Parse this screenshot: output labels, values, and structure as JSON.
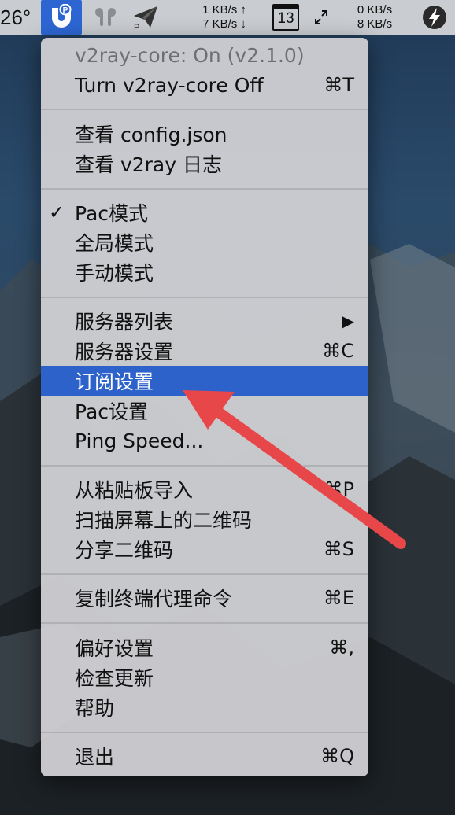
{
  "menubar": {
    "temperature": "26°",
    "net_left": {
      "up": "1 KB/s ↑",
      "down": "7 KB/s ↓"
    },
    "calendar_day": "13",
    "net_right": {
      "up": "0 KB/s",
      "down": "8 KB/s"
    }
  },
  "menu": {
    "status": "v2ray-core: On  (v2.1.0)",
    "toggle": {
      "label": "Turn v2ray-core Off",
      "shortcut": "⌘T"
    },
    "view_config": "查看 config.json",
    "view_log": "查看 v2ray 日志",
    "mode_pac": "Pac模式",
    "mode_pac_check": "✓",
    "mode_global": "全局模式",
    "mode_manual": "手动模式",
    "server_list": {
      "label": "服务器列表",
      "submenu": "▶"
    },
    "server_settings": {
      "label": "服务器设置",
      "shortcut": "⌘C"
    },
    "subscription_settings": "订阅设置",
    "pac_settings": "Pac设置",
    "ping_speed": "Ping Speed...",
    "import_clipboard": {
      "label": "从粘贴板导入",
      "shortcut": "⌘P"
    },
    "scan_qr": "扫描屏幕上的二维码",
    "share_qr": {
      "label": "分享二维码",
      "shortcut": "⌘S"
    },
    "copy_proxy_cmd": {
      "label": "复制终端代理命令",
      "shortcut": "⌘E"
    },
    "preferences": {
      "label": "偏好设置",
      "shortcut": "⌘,"
    },
    "check_updates": "检查更新",
    "help": "帮助",
    "quit": {
      "label": "退出",
      "shortcut": "⌘Q"
    }
  },
  "colors": {
    "selection": "#2c62c9",
    "arrow": "#e8474a",
    "menubar_active": "#2d66d3"
  }
}
